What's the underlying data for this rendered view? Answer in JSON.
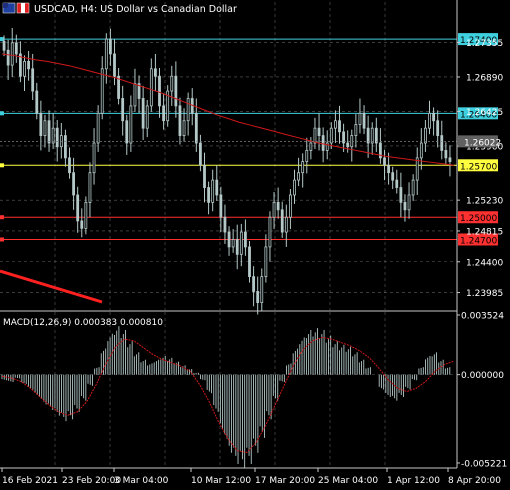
{
  "header": {
    "symbol_label": "USDCAD, H4:  US Dollar vs Canadian Dollar"
  },
  "macd_label": "MACD(12,26,9) 0.000383 0.000810",
  "colors": {
    "background": "#000000",
    "grid": "#a0a0a0",
    "candle": "#b4c8c8",
    "ma": "#d01818",
    "hline_cyan": "#3fd0e0",
    "hline_red": "#ff3030",
    "hline_yellow": "#ffff40",
    "macd_signal": "#d01818",
    "trendline": "#ff2020",
    "axis_text": "#ffffff",
    "current_price_tag": "#606060"
  },
  "chart_data": [
    {
      "type": "candlestick",
      "panel": "price",
      "ylim": [
        1.2375,
        1.279
      ],
      "y_ticks": [
        "1.27355",
        "1.26890",
        "1.26425",
        "1.25960",
        "1.25230",
        "1.24815",
        "1.24400",
        "1.23985"
      ],
      "y_tick_values": [
        1.27355,
        1.2689,
        1.26425,
        1.2596,
        1.2523,
        1.24815,
        1.244,
        1.23985
      ],
      "x_ticks": [
        "16 Feb 2021",
        "23 Feb 20:00",
        "3 Mar 04:00",
        "10 Mar 12:00",
        "17 Mar 20:00",
        "25 Mar 04:00",
        "1 Apr 12:00",
        "8 Apr 20:00"
      ],
      "current_price": {
        "label": "1.26022",
        "value": 1.26022
      },
      "horizontal_levels": [
        {
          "label": "1.27400",
          "value": 1.274,
          "color": "#3fd0e0"
        },
        {
          "label": "1.26400",
          "value": 1.264,
          "color": "#3fd0e0"
        },
        {
          "label": "1.25700",
          "value": 1.257,
          "color": "#ffff40"
        },
        {
          "label": "1.25000",
          "value": 1.25,
          "color": "#ff3030"
        },
        {
          "label": "1.24700",
          "value": 1.247,
          "color": "#ff3030"
        }
      ],
      "closes": [
        1.2725,
        1.2705,
        1.2735,
        1.272,
        1.269,
        1.271,
        1.27,
        1.267,
        1.264,
        1.261,
        1.263,
        1.26,
        1.262,
        1.2595,
        1.261,
        1.258,
        1.256,
        1.253,
        1.2495,
        1.2485,
        1.252,
        1.256,
        1.26,
        1.264,
        1.27,
        1.274,
        1.272,
        1.269,
        1.266,
        1.263,
        1.26,
        1.265,
        1.268,
        1.266,
        1.262,
        1.265,
        1.27,
        1.269,
        1.265,
        1.263,
        1.267,
        1.269,
        1.265,
        1.261,
        1.263,
        1.266,
        1.264,
        1.26,
        1.257,
        1.254,
        1.252,
        1.255,
        1.253,
        1.25,
        1.248,
        1.246,
        1.247,
        1.245,
        1.248,
        1.246,
        1.242,
        1.24,
        1.2385,
        1.242,
        1.246,
        1.25,
        1.252,
        1.251,
        1.248,
        1.25,
        1.253,
        1.255,
        1.256,
        1.2575,
        1.259,
        1.26,
        1.262,
        1.261,
        1.259,
        1.26,
        1.262,
        1.263,
        1.2615,
        1.26,
        1.2595,
        1.261,
        1.2625,
        1.264,
        1.262,
        1.26,
        1.262,
        1.26,
        1.258,
        1.257,
        1.256,
        1.255,
        1.254,
        1.252,
        1.251,
        1.253,
        1.255,
        1.258,
        1.26,
        1.262,
        1.264,
        1.263,
        1.261,
        1.259,
        1.258,
        1.2575
      ],
      "ma_values": [
        1.272,
        1.2718,
        1.2715,
        1.2712,
        1.271,
        1.2707,
        1.2704,
        1.27,
        1.2696,
        1.2692,
        1.2688,
        1.2683,
        1.2678,
        1.2673,
        1.2668,
        1.2662,
        1.2656,
        1.265,
        1.2644,
        1.2638,
        1.2633,
        1.2628,
        1.2624,
        1.262,
        1.2616,
        1.2612,
        1.2608,
        1.2604,
        1.26,
        1.2597,
        1.2594,
        1.2591,
        1.2588,
        1.2585,
        1.2582,
        1.258,
        1.2578,
        1.2576,
        1.2574,
        1.2572,
        1.257
      ],
      "indicators": [
        "Moving Average"
      ]
    },
    {
      "type": "bar",
      "panel": "macd",
      "title": "MACD(12,26,9) 0.000383 0.000810",
      "ylim": [
        -0.0054,
        0.0037
      ],
      "y_ticks": [
        "0.003524",
        "0.000000",
        "-0.005221"
      ],
      "y_tick_values": [
        0.003524,
        0.0,
        -0.005221
      ],
      "histogram": [
        -0.0003,
        -0.0004,
        -0.0002,
        -0.0005,
        -0.0008,
        -0.0012,
        -0.0016,
        -0.0019,
        -0.0022,
        -0.0025,
        -0.0024,
        -0.002,
        -0.0014,
        -0.0006,
        0.0004,
        0.0014,
        0.0022,
        0.0026,
        0.0024,
        0.0018,
        0.0012,
        0.0008,
        0.0006,
        0.0008,
        0.001,
        0.0009,
        0.0007,
        0.0005,
        0.0003,
        0.0001,
        -0.0003,
        -0.001,
        -0.002,
        -0.0032,
        -0.0042,
        -0.0048,
        -0.005,
        -0.0048,
        -0.0042,
        -0.0034,
        -0.0024,
        -0.0014,
        -0.0004,
        0.0006,
        0.0014,
        0.002,
        0.0024,
        0.0025,
        0.0024,
        0.0021,
        0.0018,
        0.0016,
        0.0015,
        0.0012,
        0.0008,
        0.0004,
        0.0,
        -0.0008,
        -0.0012,
        -0.0014,
        -0.0012,
        -0.0008,
        -0.0003,
        0.0004,
        0.001,
        0.0012,
        0.0008,
        0.0004
      ],
      "signal": [
        -0.0001,
        -0.0002,
        -0.0004,
        -0.0008,
        -0.0013,
        -0.0018,
        -0.0022,
        -0.0024,
        -0.0022,
        -0.0016,
        -0.0006,
        0.0006,
        0.0016,
        0.0021,
        0.002,
        0.0016,
        0.0012,
        0.0009,
        0.0007,
        0.0005,
        0.0002,
        -0.0006,
        -0.0016,
        -0.0028,
        -0.0038,
        -0.0045,
        -0.0046,
        -0.004,
        -0.003,
        -0.0018,
        -0.0006,
        0.0006,
        0.0015,
        0.002,
        0.0022,
        0.0021,
        0.0019,
        0.0017,
        0.0014,
        0.001,
        0.0004,
        -0.0003,
        -0.0008,
        -0.001,
        -0.0008,
        -0.0004,
        0.0002,
        0.0006,
        0.0008
      ]
    }
  ]
}
